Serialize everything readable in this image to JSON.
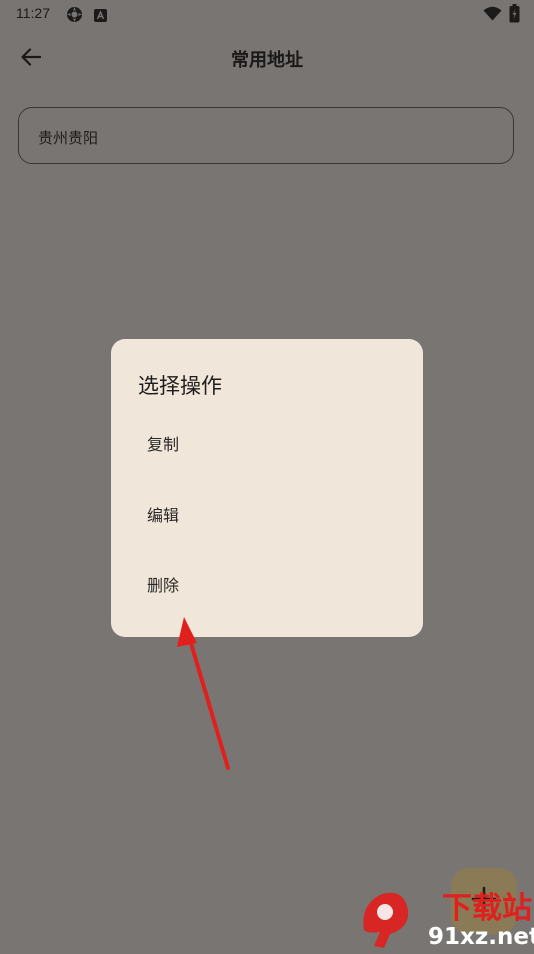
{
  "status_bar": {
    "time": "11:27",
    "icons": [
      "settings-app-icon",
      "a-box-icon",
      "wifi-icon",
      "battery-icon"
    ]
  },
  "app_bar": {
    "title": "常用地址",
    "back_icon": "back-arrow-icon"
  },
  "address_list": [
    {
      "text": "贵州贵阳"
    }
  ],
  "dialog": {
    "title": "选择操作",
    "items": [
      {
        "label": "复制"
      },
      {
        "label": "编辑"
      },
      {
        "label": "删除"
      }
    ]
  },
  "fab": {
    "icon": "plus-icon"
  },
  "watermark": {
    "top_text": "下载站",
    "bottom_text": "91xz.net",
    "logo_text": "9"
  },
  "annotation": {
    "icon": "red-arrow-icon",
    "color": "#e0201c"
  },
  "colors": {
    "scrim_background": "#797572",
    "dialog_background": "#f1e6da",
    "accent_red": "#e0201c"
  }
}
